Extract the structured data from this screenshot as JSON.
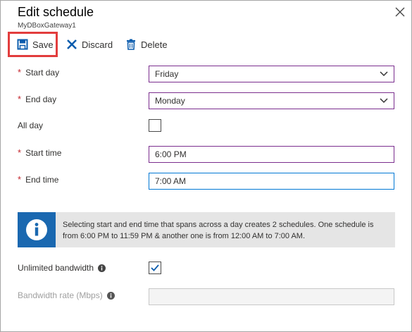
{
  "panel": {
    "title": "Edit schedule",
    "subtitle": "MyDBoxGateway1"
  },
  "toolbar": {
    "save_label": "Save",
    "discard_label": "Discard",
    "delete_label": "Delete"
  },
  "form": {
    "start_day": {
      "label": "Start day",
      "required": true,
      "value": "Friday"
    },
    "end_day": {
      "label": "End day",
      "required": true,
      "value": "Monday"
    },
    "all_day": {
      "label": "All day",
      "checked": false
    },
    "start_time": {
      "label": "Start time",
      "required": true,
      "value": "6:00 PM"
    },
    "end_time": {
      "label": "End time",
      "required": true,
      "value": "7:00 AM"
    },
    "unlimited_bandwidth": {
      "label": "Unlimited bandwidth",
      "checked": true
    },
    "bandwidth_rate": {
      "label": "Bandwidth rate (Mbps)",
      "value": "",
      "disabled": true
    }
  },
  "info_banner": {
    "text": "Selecting start and end time that spans across a day creates 2 schedules. One schedule is from 6:00 PM to 11:59 PM & another one is from 12:00 AM to 7:00 AM."
  },
  "colors": {
    "accent_blue": "#0078d4",
    "select_border_purple": "#7b2e8e",
    "required_red": "#c4262e",
    "highlight_red": "#e23d3d",
    "info_blue": "#1a68b0",
    "banner_bg": "#e5e5e5"
  },
  "required_marker": "*",
  "icons": {
    "save": "save-icon",
    "discard": "x-icon",
    "delete": "trash-icon",
    "close": "close-icon",
    "info": "info-icon",
    "dropdown": "chevron-down-icon"
  }
}
